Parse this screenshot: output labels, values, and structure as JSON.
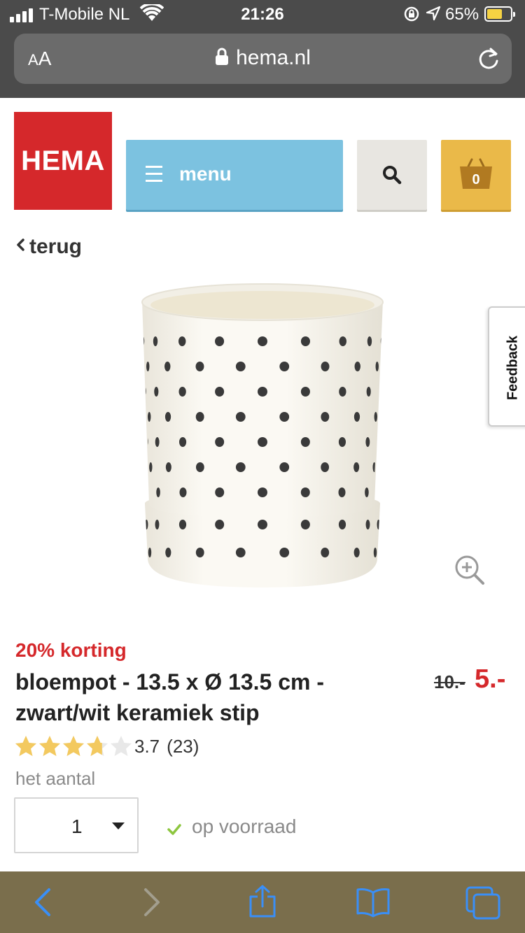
{
  "status_bar": {
    "carrier": "T-Mobile NL",
    "time": "21:26",
    "battery_percent": "65%",
    "battery_level": 0.65,
    "battery_color": "#f6d343"
  },
  "browser": {
    "text_size_label_small": "A",
    "text_size_label_large": "A",
    "domain": "hema.nl"
  },
  "header": {
    "logo_text": "HEMA",
    "menu_label": "menu",
    "cart_count": "0",
    "brand_color": "#d5282b",
    "menu_color": "#7cc2e0",
    "cart_color": "#eab949"
  },
  "nav": {
    "back_label": "terug"
  },
  "feedback": {
    "label": "Feedback"
  },
  "product": {
    "discount_label": "20% korting",
    "title": "bloempot - 13.5 x Ø 13.5 cm - zwart/wit keramiek stip",
    "old_price": "10.-",
    "new_price": "5.-",
    "rating_value": "3.7",
    "rating_value_num": 3.7,
    "rating_max": 5,
    "review_count": "(23)",
    "quantity_label": "het aantal",
    "quantity_value": "1",
    "stock_status": "op voorraad"
  },
  "icons": {
    "signal": "cell-signal-icon",
    "wifi": "wifi-icon",
    "orientation_lock": "orientation-lock-icon",
    "location": "location-arrow-icon",
    "padlock": "padlock-icon",
    "reload": "reload-icon",
    "hamburger": "hamburger-icon",
    "search": "search-icon",
    "basket": "basket-icon",
    "zoom": "zoom-in-icon",
    "check": "check-icon",
    "back": "back-arrow-icon",
    "forward": "forward-arrow-icon",
    "share": "share-icon",
    "bookmarks": "bookmarks-icon",
    "tabs": "tabs-icon"
  }
}
